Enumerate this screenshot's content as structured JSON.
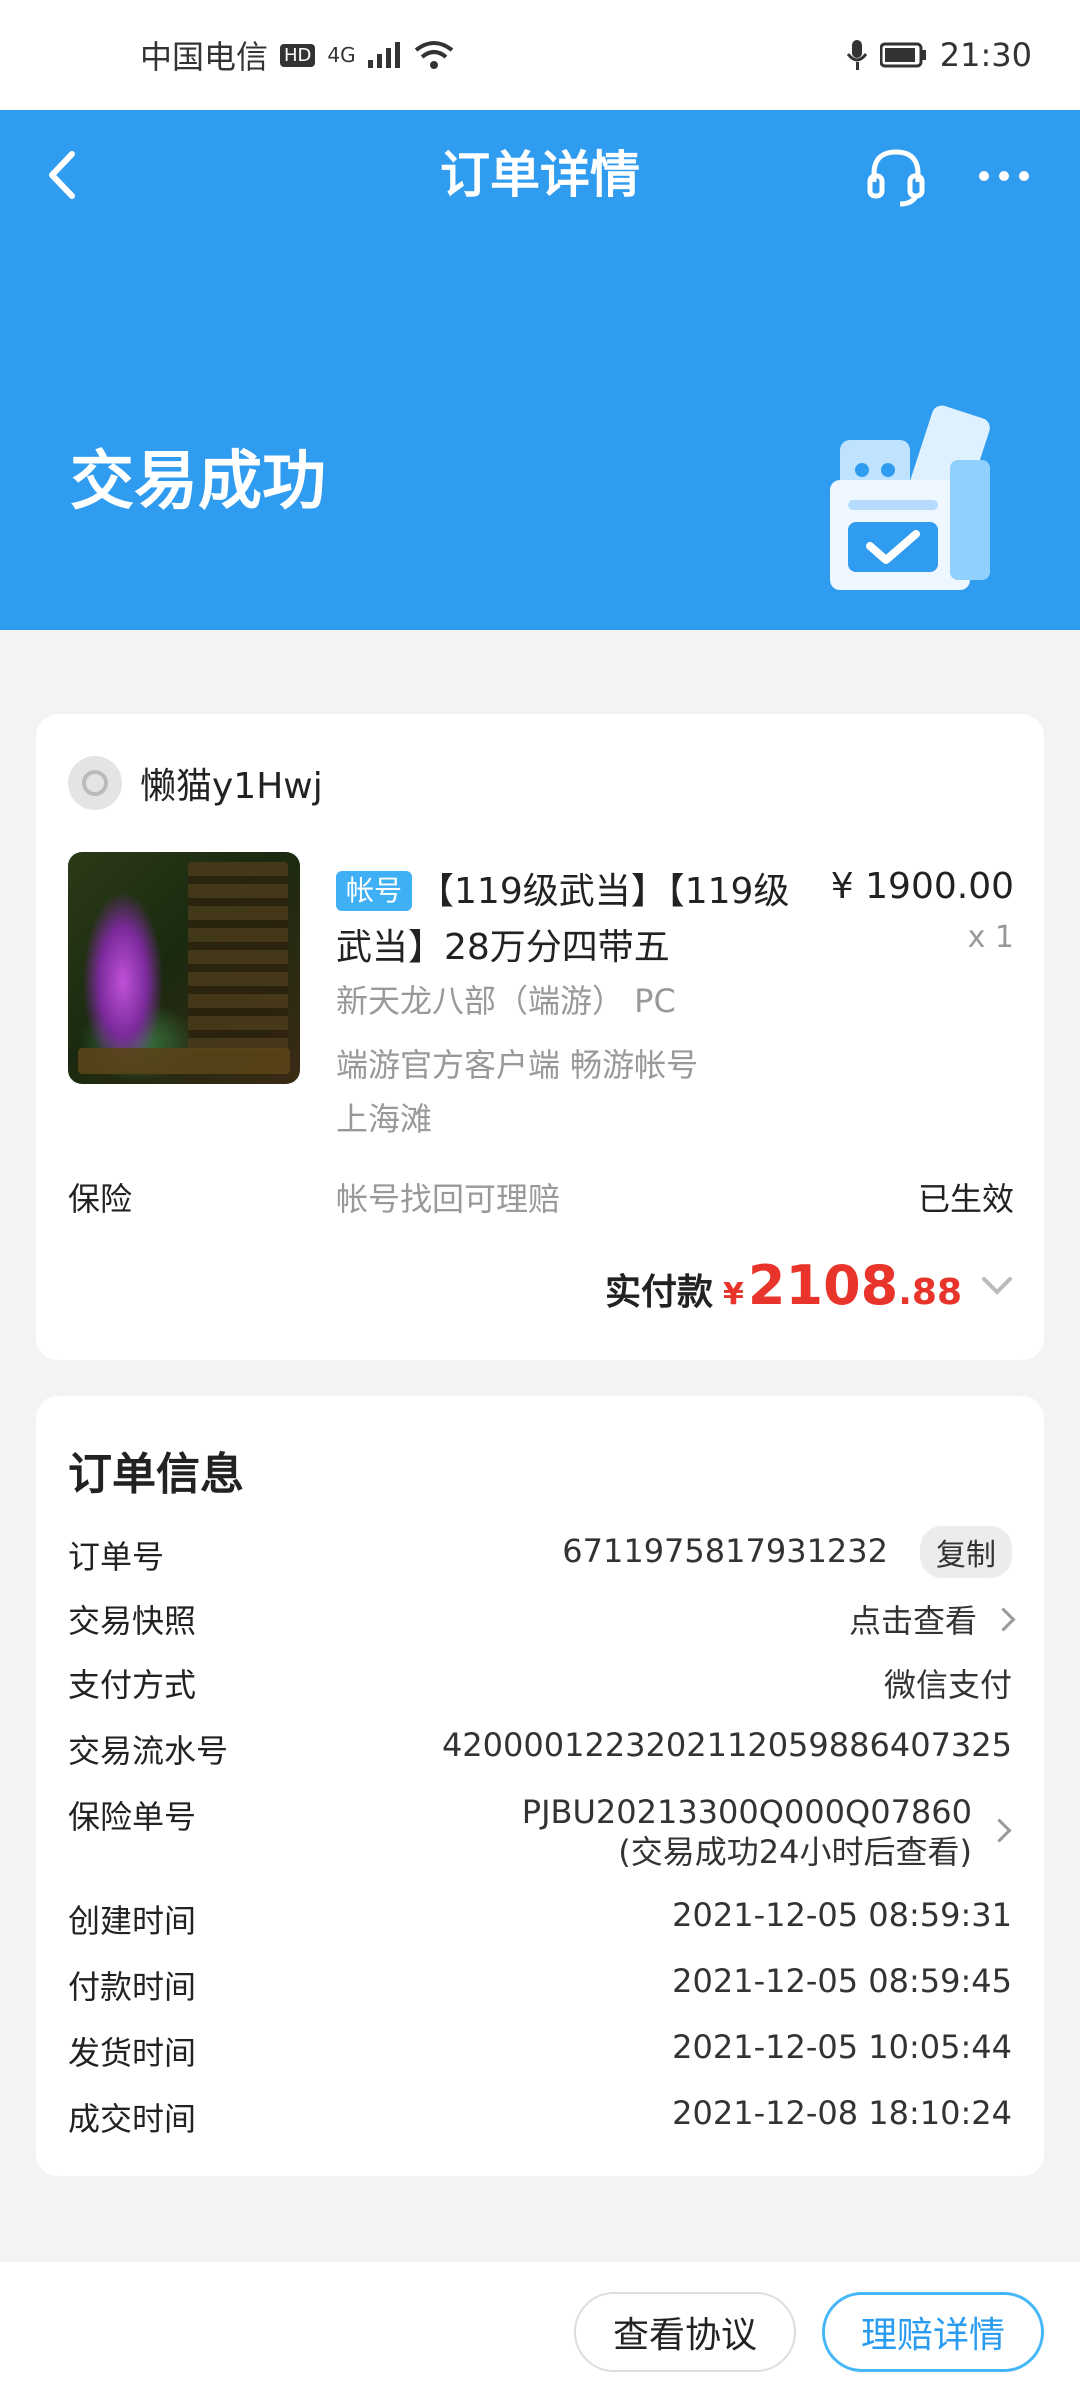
{
  "status_bar": {
    "carrier": "中国电信",
    "hd": "HD",
    "network": "4G",
    "time": "21:30"
  },
  "nav": {
    "title": "订单详情",
    "icons": {
      "back": "back-arrow-icon",
      "service": "headset-icon",
      "more": "more-icon"
    }
  },
  "header": {
    "status": "交易成功",
    "accent_color": "#2f9cf0"
  },
  "product_card": {
    "seller": "懒猫y1Hwj",
    "tag": "帐号",
    "title": "【119级武当】【119级武当】28万分四带五",
    "price": "¥ 1900.00",
    "qty": "x 1",
    "game": "新天龙八部（端游） PC",
    "client": "端游官方客户端 畅游帐号",
    "server": "上海滩",
    "insurance": {
      "label": "保险",
      "desc": "帐号找回可理赔",
      "status": "已生效"
    },
    "paid": {
      "label": "实付款",
      "currency": "¥",
      "integer": "2108",
      "decimal": ".88",
      "color": "#e8342a"
    }
  },
  "order_info": {
    "title": "订单信息",
    "order_no": {
      "label": "订单号",
      "value": "6711975817931232",
      "copy_label": "复制"
    },
    "snapshot": {
      "label": "交易快照",
      "value": "点击查看"
    },
    "pay_method": {
      "label": "支付方式",
      "value": "微信支付"
    },
    "serial_no": {
      "label": "交易流水号",
      "value": "4200001223202112059886407325"
    },
    "insurance_no": {
      "label": "保险单号",
      "value": "PJBU20213300Q000Q07860",
      "note": "(交易成功24小时后查看)"
    },
    "created": {
      "label": "创建时间",
      "value": "2021-12-05 08:59:31"
    },
    "paid_time": {
      "label": "付款时间",
      "value": "2021-12-05 08:59:45"
    },
    "shipped": {
      "label": "发货时间",
      "value": "2021-12-05 10:05:44"
    },
    "completed": {
      "label": "成交时间",
      "value": "2021-12-08 18:10:24"
    }
  },
  "bottom": {
    "agreement": "查看协议",
    "claim": "理赔详情"
  }
}
